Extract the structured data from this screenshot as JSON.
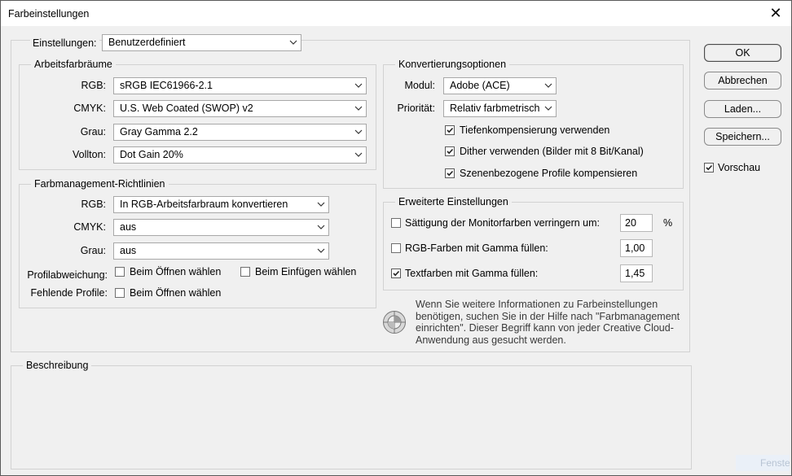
{
  "window": {
    "title": "Farbeinstellungen",
    "close_symbol": "✕"
  },
  "settings": {
    "label": "Einstellungen:",
    "value": "Benutzerdefiniert"
  },
  "workspaces": {
    "legend": "Arbeitsfarbräume",
    "rows": [
      {
        "label": "RGB:",
        "value": "sRGB IEC61966-2.1"
      },
      {
        "label": "CMYK:",
        "value": "U.S. Web Coated (SWOP) v2"
      },
      {
        "label": "Grau:",
        "value": "Gray Gamma 2.2"
      },
      {
        "label": "Vollton:",
        "value": "Dot Gain 20%"
      }
    ]
  },
  "policies": {
    "legend": "Farbmanagement-Richtlinien",
    "rows": [
      {
        "label": "RGB:",
        "value": "In RGB-Arbeitsfarbraum konvertieren"
      },
      {
        "label": "CMYK:",
        "value": "aus"
      },
      {
        "label": "Grau:",
        "value": "aus"
      }
    ],
    "mismatch_label": "Profilabweichung:",
    "mismatch_open": "Beim Öffnen wählen",
    "mismatch_paste": "Beim Einfügen wählen",
    "missing_label": "Fehlende Profile:",
    "missing_open": "Beim Öffnen wählen"
  },
  "conversion": {
    "legend": "Konvertierungsoptionen",
    "engine_label": "Modul:",
    "engine_value": "Adobe (ACE)",
    "intent_label": "Priorität:",
    "intent_value": "Relativ farbmetrisch",
    "bpc": "Tiefenkompensierung verwenden",
    "dither": "Dither verwenden (Bilder mit 8 Bit/Kanal)",
    "scene": "Szenenbezogene Profile kompensieren"
  },
  "advanced": {
    "legend": "Erweiterte Einstellungen",
    "desaturate_label": "Sättigung der Monitorfarben verringern um:",
    "desaturate_value": "20",
    "desaturate_unit": "%",
    "blend_rgb_label": "RGB-Farben mit Gamma füllen:",
    "blend_rgb_value": "1,00",
    "blend_text_label": "Textfarben mit Gamma füllen:",
    "blend_text_value": "1,45"
  },
  "info": {
    "text": "Wenn Sie weitere Informationen zu Farbeinstellungen benötigen, suchen Sie in der Hilfe nach \"Farbmanagement einrichten\". Dieser Begriff kann von jeder Creative Cloud-Anwendung aus gesucht werden."
  },
  "description": {
    "legend": "Beschreibung"
  },
  "buttons": {
    "ok": "OK",
    "cancel": "Abbrechen",
    "load": "Laden...",
    "save": "Speichern..."
  },
  "preview": {
    "label": "Vorschau"
  },
  "watermark": "Fenster"
}
